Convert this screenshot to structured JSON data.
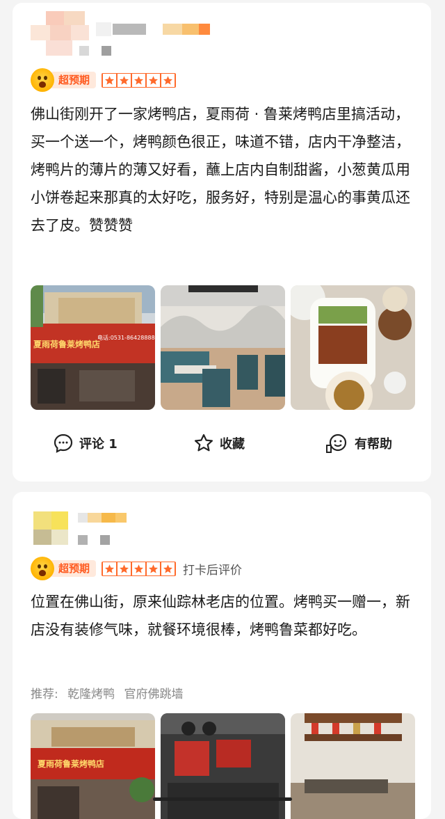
{
  "reviews": [
    {
      "badge": "超预期",
      "rating": 5,
      "text": "佛山街刚开了一家烤鸭店，夏雨荷 · 鲁莱烤鸭店里搞活动，买一个送一个，烤鸭颜色很正，味道不错，店内干净整洁，烤鸭片的薄片的薄又好看，蘸上店内自制甜酱，小葱黄瓜用小饼卷起来那真的太好吃，服务好，特别是温心的事黄瓜还去了皮。赞赞赞",
      "photos": [
        {
          "sign_text": "夏雨荷鲁莱烤鸭店",
          "phone": "电话:0531-86428888"
        },
        {
          "caption": ""
        },
        {
          "caption": ""
        }
      ],
      "actions": {
        "comment": "评论 1",
        "favorite": "收藏",
        "helpful": "有帮助"
      }
    },
    {
      "badge": "超预期",
      "rating": 5,
      "after_label": "打卡后评价",
      "text": "位置在佛山街，原来仙踪林老店的位置。烤鸭买一赠一，新店没有装修气味，就餐环境很棒，烤鸭鲁菜都好吃。",
      "recommend_label": "推荐:",
      "recommend_items": [
        "乾隆烤鸭",
        "官府佛跳墙"
      ],
      "photos": [
        {
          "sign_text": "夏雨荷鲁莱烤鸭店"
        },
        {
          "caption": ""
        },
        {
          "caption": ""
        }
      ]
    }
  ],
  "colors": {
    "accent": "#ff6a2b",
    "badge_bg": "#ffe9dc",
    "badge_text": "#ff5a1f"
  }
}
